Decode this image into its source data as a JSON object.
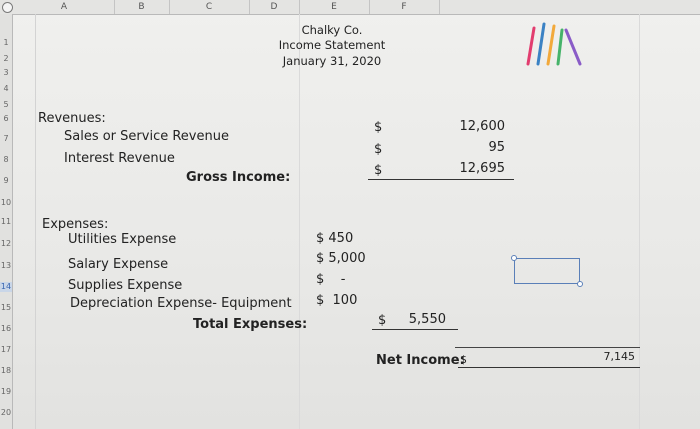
{
  "columns": [
    "A",
    "B",
    "C",
    "D",
    "E",
    "F"
  ],
  "rows": [
    "1",
    "2",
    "3",
    "4",
    "5",
    "6",
    "7",
    "8",
    "9",
    "10",
    "11",
    "12",
    "13",
    "14",
    "15",
    "16",
    "17",
    "18",
    "19",
    "20"
  ],
  "selected_row": "14",
  "header": {
    "company": "Chalky Co.",
    "statement": "Income Statement",
    "date": "January 31, 2020"
  },
  "revenues": {
    "label": "Revenues:",
    "items": [
      {
        "name": "Sales or Service Revenue",
        "currency": "$",
        "amount": "12,600"
      },
      {
        "name": "Interest Revenue",
        "currency": "$",
        "amount": "95"
      }
    ],
    "total_label": "Gross Income:",
    "total_currency": "$",
    "total_amount": "12,695"
  },
  "expenses": {
    "label": "Expenses:",
    "items": [
      {
        "name": "Utilities Expense",
        "amount": "$ 450"
      },
      {
        "name": "Salary Expense",
        "amount": "$ 5,000"
      },
      {
        "name": "Supplies Expense",
        "amount": "$    -"
      },
      {
        "name": "Depreciation Expense- Equipment",
        "amount": "$  100"
      }
    ],
    "total_label": "Total Expenses:",
    "total_currency": "$",
    "total_amount": "5,550"
  },
  "net_income": {
    "label": "Net Income:",
    "currency": "$",
    "amount": "7,145"
  },
  "colors": {
    "accent": "#5a7fb8",
    "selected_row": "#c9d6e8"
  }
}
